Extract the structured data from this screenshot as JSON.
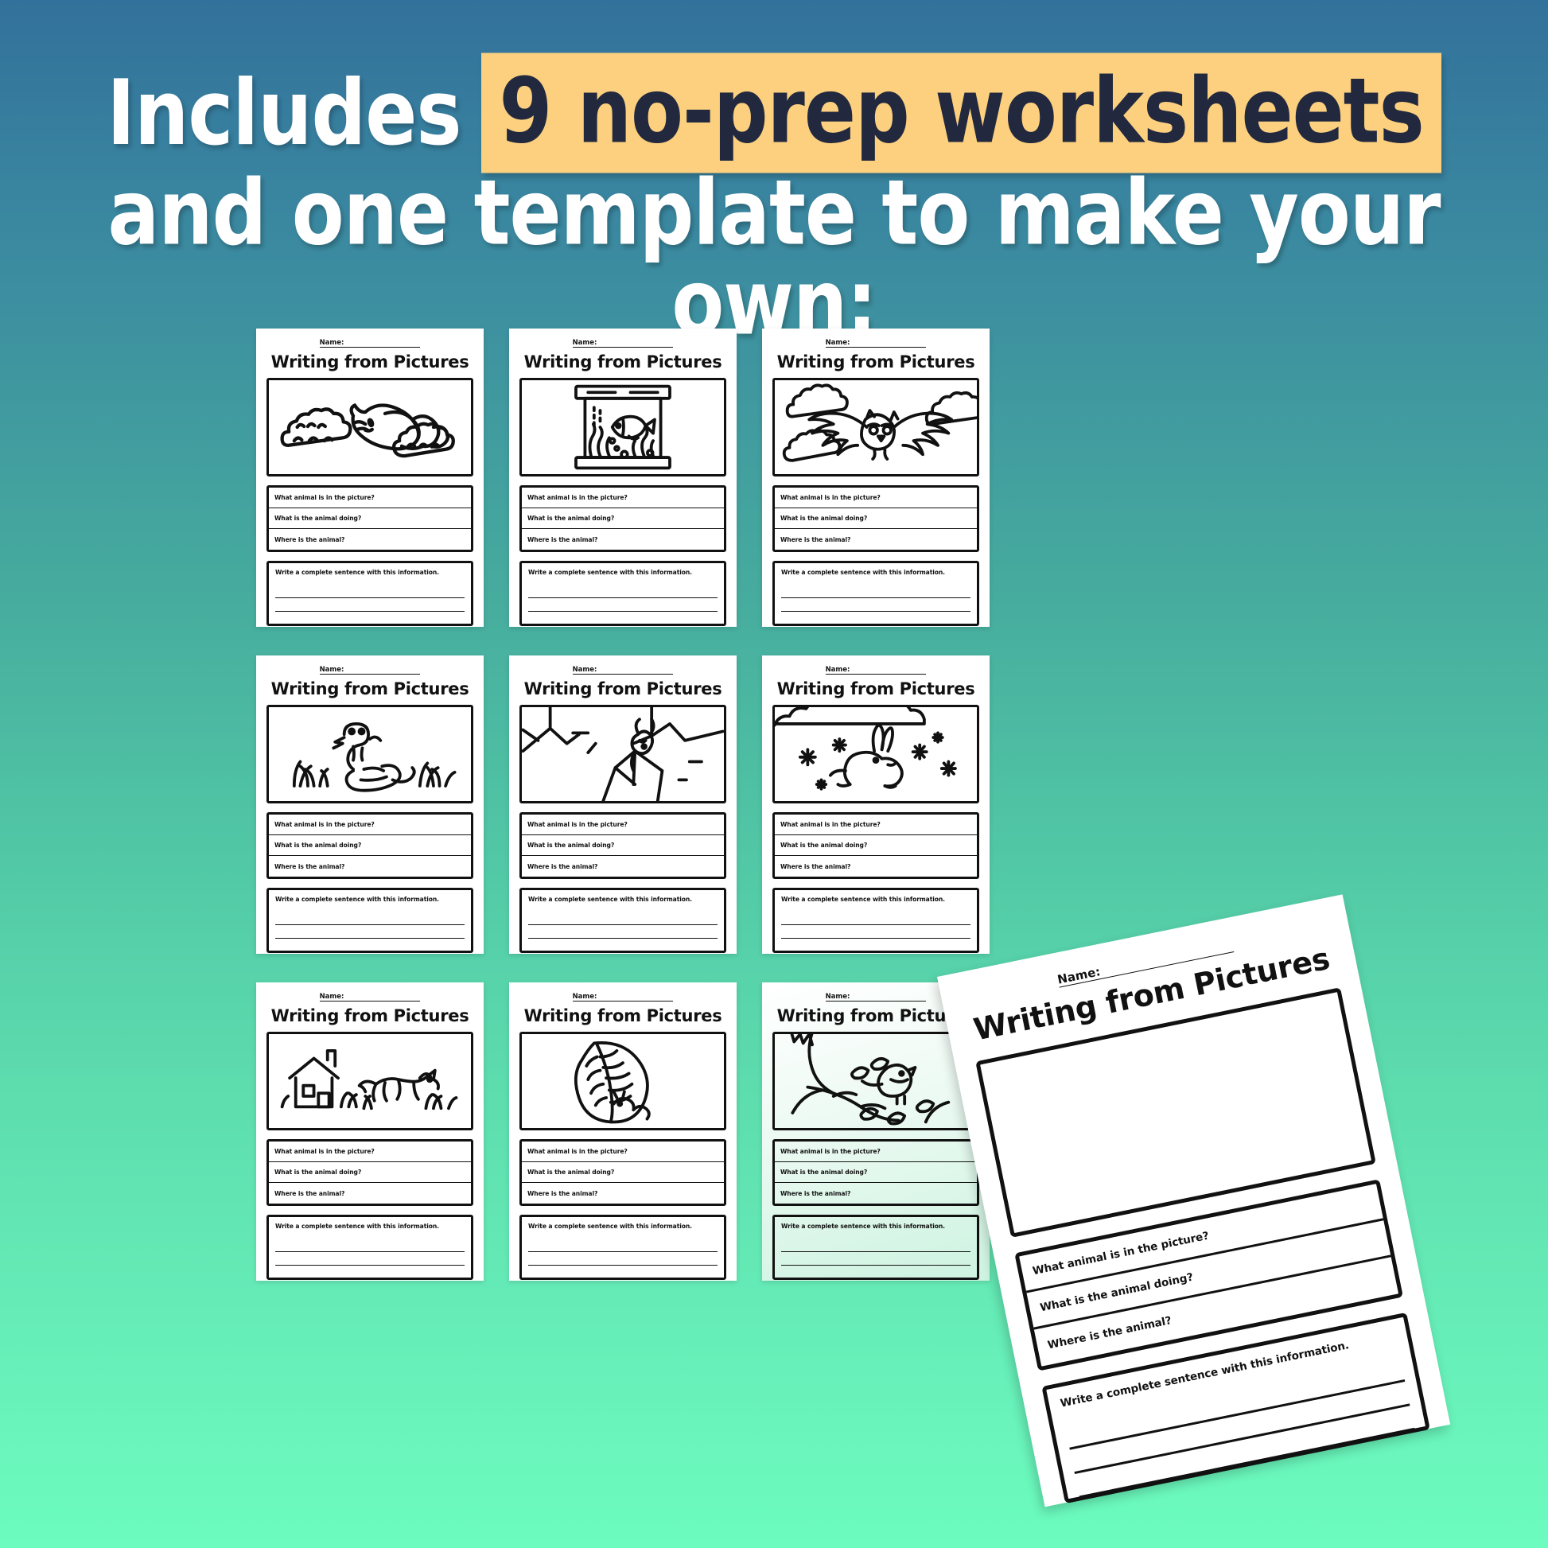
{
  "background": {
    "gradient_from": "#32719b",
    "gradient_to": "#6cfcbf"
  },
  "header": {
    "line1_plain": "Includes",
    "line1_highlight": "9 no-prep worksheets",
    "line2": "and one template to make your own:",
    "highlight_color": "#fcd07e",
    "text_color": "#ffffff",
    "highlight_text_color": "#22293f"
  },
  "worksheet": {
    "name_label": "Name:",
    "title": "Writing from Pictures",
    "questions": [
      "What animal is in the picture?",
      "What is the animal doing?",
      "Where is the animal?"
    ],
    "sentence_prompt": "Write a complete sentence with this information."
  },
  "sheets": [
    {
      "illustration": "cat-sleeping-on-clouds-icon",
      "tinted": false
    },
    {
      "illustration": "fish-in-aquarium-icon",
      "tinted": false
    },
    {
      "illustration": "owl-flying-in-clouds-icon",
      "tinted": false
    },
    {
      "illustration": "snake-in-grass-icon",
      "tinted": false
    },
    {
      "illustration": "mountain-goat-on-rocks-icon",
      "tinted": false
    },
    {
      "illustration": "rabbit-hopping-in-snow-icon",
      "tinted": false
    },
    {
      "illustration": "dog-running-by-house-icon",
      "tinted": false
    },
    {
      "illustration": "caterpillar-on-leaf-icon",
      "tinted": false
    },
    {
      "illustration": "bird-on-tree-branch-icon",
      "tinted": true
    }
  ],
  "template_card": {
    "illustration": "blank-picture-box",
    "rotated": true
  }
}
